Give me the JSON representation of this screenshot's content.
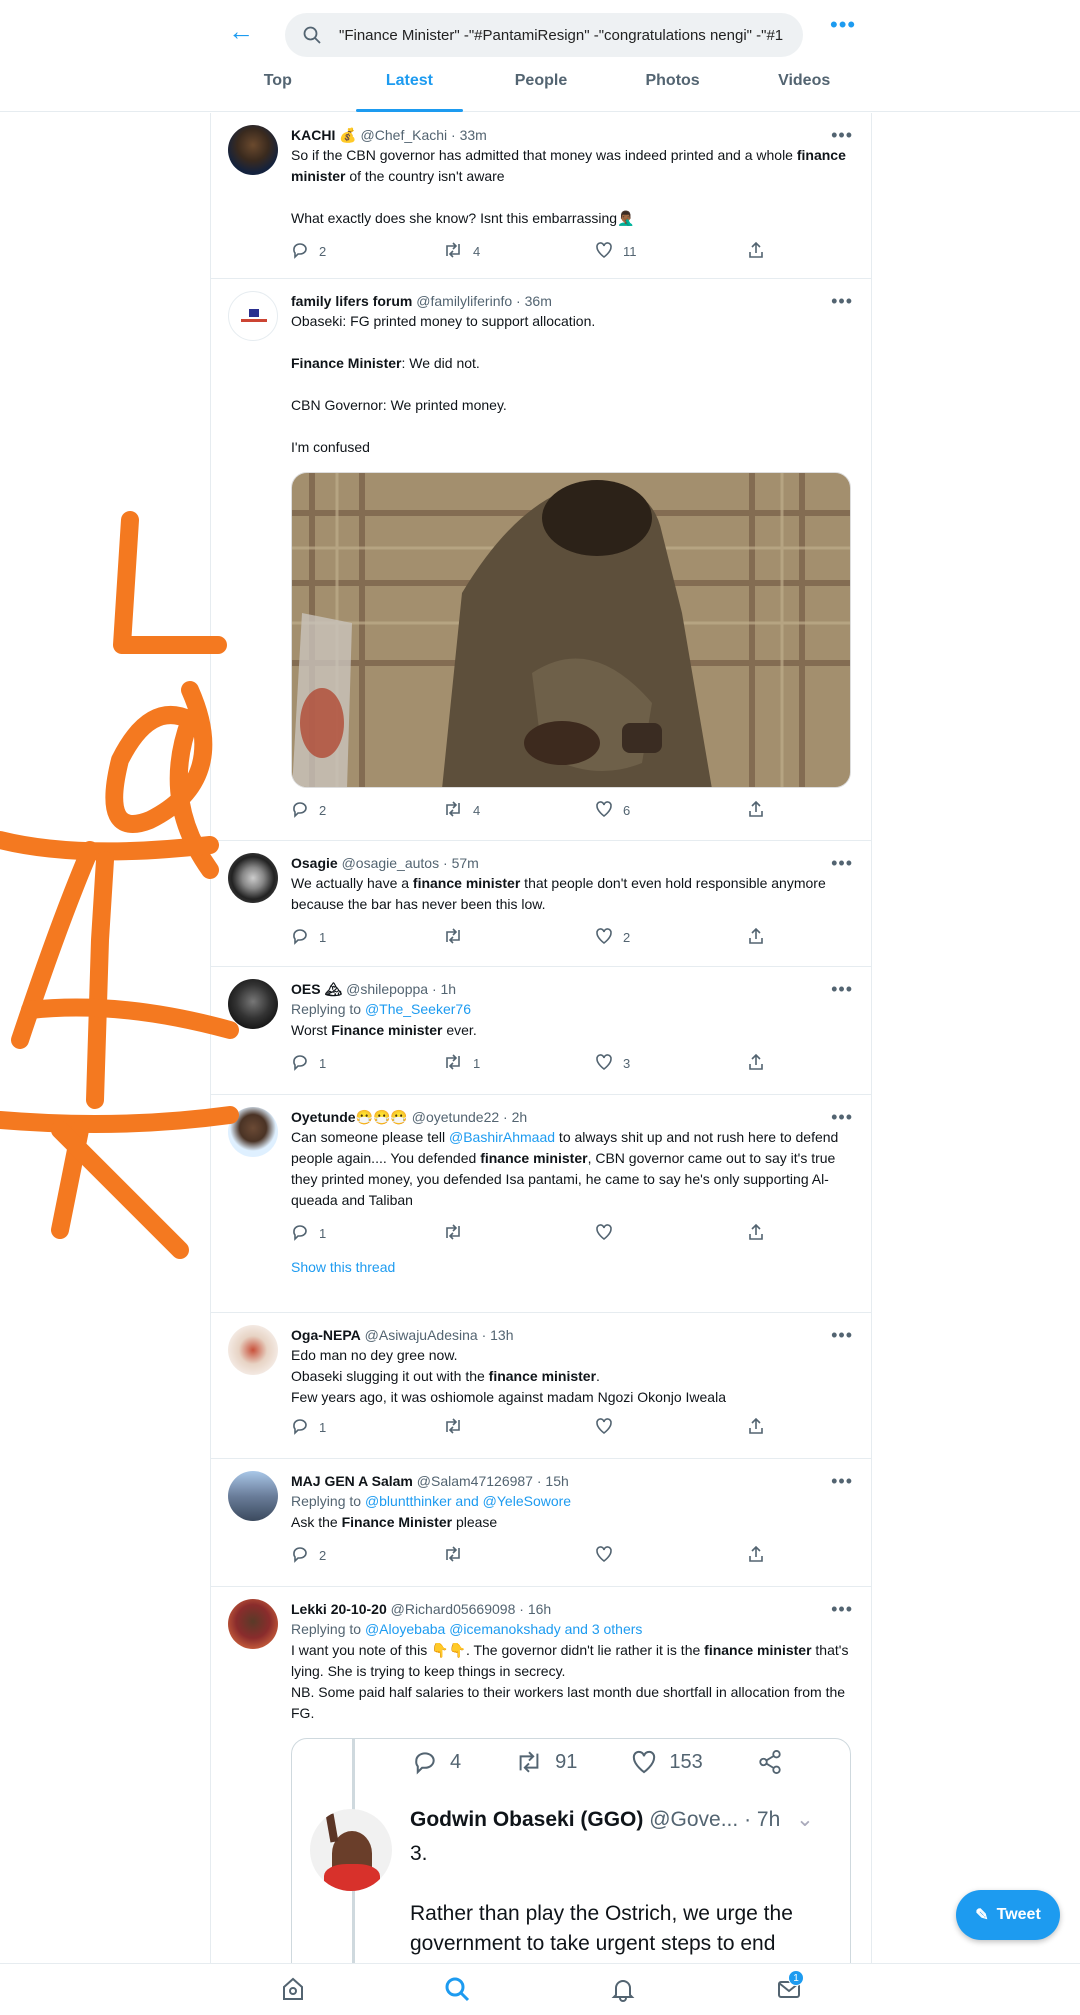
{
  "search": {
    "query": "\"Finance Minister\" -\"#PantamiResign\" -\"congratulations nengi\" -\"#1"
  },
  "tabs": [
    {
      "label": "Top"
    },
    {
      "label": "Latest"
    },
    {
      "label": "People"
    },
    {
      "label": "Photos"
    },
    {
      "label": "Videos"
    }
  ],
  "active_tab": "Latest",
  "tweets": [
    {
      "name": "KACHI 💰",
      "handle": "@Chef_Kachi",
      "time": "33m",
      "line1a": "So if the CBN governor has admitted that money was indeed printed and a whole ",
      "line1b": "finance minister",
      "line1c": " of the country isn't aware",
      "line2": "What exactly does she know? Isnt this embarrassing🤦🏾‍♂️",
      "replies": "2",
      "retweets": "4",
      "likes": "11"
    },
    {
      "name": "family lifers forum",
      "handle": "@familyliferinfo",
      "time": "36m",
      "p1": "Obaseki: FG printed money to support allocation.",
      "p2b": "Finance Minister",
      "p2": ": We did not.",
      "p3": "CBN Governor: We printed money.",
      "p4": "I'm  confused",
      "replies": "2",
      "retweets": "4",
      "likes": "6"
    },
    {
      "name": "Osagie",
      "handle": "@osagie_autos",
      "time": "57m",
      "a": "We actually have a ",
      "b": "finance minister",
      "c": " that people don't even hold responsible anymore because the bar has never been this low.",
      "replies": "1",
      "retweets": "",
      "likes": "2"
    },
    {
      "name": "OES 🏔",
      "handle": "@shilepoppa",
      "time": "1h",
      "reply_prefix": "Replying to ",
      "reply_to": "@The_Seeker76",
      "a": "Worst ",
      "b": "Finance minister",
      "c": " ever.",
      "replies": "1",
      "retweets": "1",
      "likes": "3"
    },
    {
      "name": "Oyetunde😷😷😷",
      "handle": "@oyetunde22",
      "time": "2h",
      "a": "Can someone please tell ",
      "mention": "@BashirAhmaad",
      "b": " to always shit up and not rush here to defend people again....  You defended ",
      "c": "finance minister",
      "d": ", CBN governor came out to say it's true they printed money, you defended Isa pantami, he came to say he's only supporting Al-queada and Taliban",
      "replies": "1",
      "retweets": "",
      "likes": "",
      "thread": "Show this thread"
    },
    {
      "name": "Oga-NEPA",
      "handle": "@AsiwajuAdesina",
      "time": "13h",
      "l1": "Edo man no dey gree now.",
      "l2a": "Obaseki slugging it out with the ",
      "l2b": "finance minister",
      "l2c": ".",
      "l3": "Few years ago,  it was oshiomole against madam Ngozi Okonjo Iweala",
      "replies": "1",
      "retweets": "",
      "likes": ""
    },
    {
      "name": "MAJ GEN A Salam",
      "handle": "@Salam47126987",
      "time": "15h",
      "reply_prefix": "Replying to ",
      "reply_to": "@bluntthinker and @YeleSowore",
      "a": "Ask the ",
      "b": "Finance Minister",
      "c": " please",
      "replies": "2",
      "retweets": "",
      "likes": ""
    },
    {
      "name": "Lekki 20-10-20",
      "handle": "@Richard05669098",
      "time": "16h",
      "reply_prefix": "Replying to ",
      "reply_to": "@Aloyebaba @icemanokshady and 3 others",
      "a": "I want you note of this 👇👇. The governor didn't lie rather it is the ",
      "b": "finance minister",
      "c": " that's lying. She is trying to keep things in secrecy.",
      "d": "NB. Some paid half salaries to their workers last month due shortfall in allocation from the FG.",
      "quote": {
        "replies": "4",
        "retweets": "91",
        "likes": "153",
        "name": "Godwin Obaseki (GGO)",
        "handle": "@Gove...",
        "time": "· 7h",
        "l1": "3.",
        "l2": "Rather than play the Ostrich, we urge the government to take urgent steps to end"
      }
    }
  ],
  "fab": {
    "label": "Tweet"
  },
  "annotation": "After",
  "colors": {
    "accent": "#1d9bf0",
    "scrawl": "#f47920"
  }
}
